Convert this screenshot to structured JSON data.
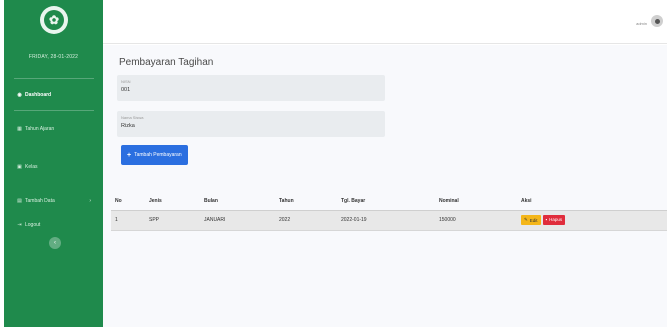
{
  "sidebar": {
    "date": "FRIDAY, 28-01-2022",
    "items": [
      {
        "label": "Dashboard",
        "icon": "tachometer-icon"
      },
      {
        "label": "Tahun Ajaran",
        "icon": "calendar-icon"
      },
      {
        "label": "Kelas",
        "icon": "school-icon"
      },
      {
        "label": "Tambah Data",
        "icon": "folder-icon"
      },
      {
        "label": "Logout",
        "icon": "logout-icon"
      }
    ]
  },
  "topbar": {
    "user": "admin"
  },
  "page": {
    "title": "Pembayaran Tagihan",
    "fields": [
      {
        "label": "NISN",
        "value": "001"
      },
      {
        "label": "Nama Siswa",
        "value": "Rizka"
      }
    ],
    "add_button": "Tambah Pembayaran"
  },
  "table": {
    "headers": [
      "No",
      "Jenis",
      "Bulan",
      "Tahun",
      "Tgl. Bayar",
      "Nominal",
      "Aksi"
    ],
    "rows": [
      {
        "no": "1",
        "jenis": "SPP",
        "bulan": "JANUARI",
        "tahun": "2022",
        "tgl": "2022-01-19",
        "nominal": "150000",
        "edit": "Edit",
        "hapus": "Hapus"
      }
    ]
  },
  "colors": {
    "sidebar": "#1f8a4c",
    "primary": "#2b6fe0",
    "warning": "#f4b619",
    "danger": "#e02d3c"
  }
}
